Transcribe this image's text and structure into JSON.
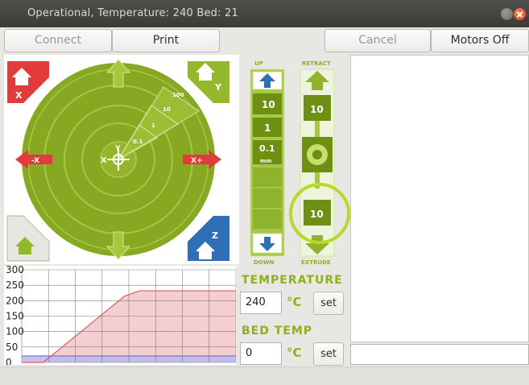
{
  "window": {
    "title": "Operational, Temperature: 240 Bed: 21"
  },
  "toolbar": {
    "connect_label": "Connect",
    "print_label": "Print",
    "cancel_label": "Cancel",
    "motors_off_label": "Motors Off"
  },
  "xy_control": {
    "steps": [
      "100",
      "10",
      "1",
      "0.1"
    ],
    "home_x": "X",
    "home_y": "Y",
    "home_z": "Z",
    "center_labels": {
      "x": "X",
      "y": "Y"
    },
    "minus_x": "-X",
    "plus_x": "X+"
  },
  "z_control": {
    "up_label": "UP",
    "down_label": "DOWN",
    "steps": [
      "10",
      "1",
      "0.1",
      "mm"
    ]
  },
  "extruder": {
    "retract_label": "RETRACT",
    "extrude_label": "EXTRUDE",
    "retract_amount": "10",
    "extrude_amount": "10"
  },
  "temperature": {
    "heading": "TEMPERATURE",
    "value": "240",
    "unit": "°C",
    "set_label": "set"
  },
  "bed_temp": {
    "heading": "BED TEMP",
    "value": "0",
    "unit": "°C",
    "set_label": "set"
  },
  "chart_data": {
    "type": "line",
    "title": "",
    "xlabel": "",
    "ylabel": "",
    "ylim": [
      0,
      300
    ],
    "yticks": [
      "300",
      "250",
      "200",
      "150",
      "100",
      "50",
      "0"
    ],
    "grid": true,
    "series": [
      {
        "x": [
          0,
          10,
          48,
          55,
          100
        ],
        "values": [
          0,
          0,
          215,
          232,
          232
        ],
        "color": "#e05a5a",
        "fill": "#f4c9cc"
      },
      {
        "x": [
          0,
          100
        ],
        "values": [
          21,
          21
        ],
        "color": "#6f6fd0",
        "fill": "#bcbcec"
      }
    ]
  }
}
